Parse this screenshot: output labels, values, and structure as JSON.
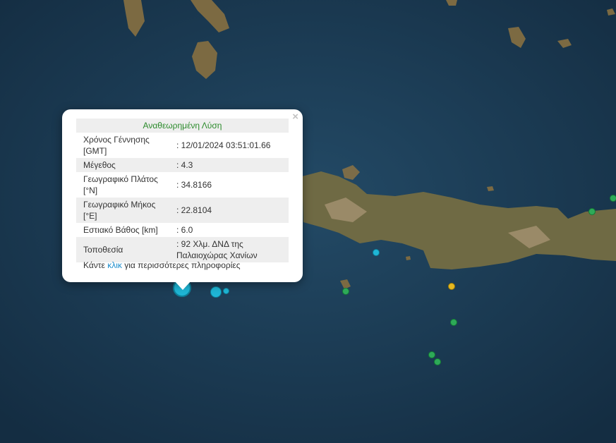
{
  "popup": {
    "title": "Αναθεωρημένη Λύση",
    "close_symbol": "×",
    "rows": [
      {
        "label": "Χρόνος Γέννησης [GMT]",
        "value": ": 12/01/2024 03:51:01.66"
      },
      {
        "label": "Μέγεθος",
        "value": ": 4.3"
      },
      {
        "label": "Γεωγραφικό Πλάτος [°N]",
        "value": ": 34.8166"
      },
      {
        "label": "Γεωγραφικό Μήκος [°E]",
        "value": ": 22.8104"
      },
      {
        "label": "Εστιακό Βάθος [km]",
        "value": ": 6.0"
      },
      {
        "label": "Τοποθεσία",
        "value": ": 92 Χλμ. ΔΝΔ της Παλαιοχώρας Χανίων"
      }
    ],
    "more_prefix": "Κάντε ",
    "more_link": "κλικ",
    "more_suffix": " για περισσότερες πληροφορίες"
  },
  "colors": {
    "sea": "#1b3a52",
    "land": "#7d6e48",
    "marker_cyan": "#1fb6d6",
    "marker_green": "#2eaa58",
    "marker_yellow": "#e6b820",
    "popup_title": "#2a8a2a",
    "link": "#1a8ccc"
  },
  "markers": [
    {
      "id": "quake-selected",
      "color": "marker_cyan",
      "size": "large"
    },
    {
      "id": "quake-cyan-2",
      "color": "marker_cyan",
      "size": "medium"
    },
    {
      "id": "quake-cyan-3",
      "color": "marker_cyan",
      "size": "small"
    },
    {
      "id": "quake-cyan-4",
      "color": "marker_cyan",
      "size": "small"
    },
    {
      "id": "quake-green-1",
      "color": "marker_green",
      "size": "small"
    },
    {
      "id": "quake-green-2",
      "color": "marker_green",
      "size": "small"
    },
    {
      "id": "quake-green-3",
      "color": "marker_green",
      "size": "small"
    },
    {
      "id": "quake-green-4",
      "color": "marker_green",
      "size": "small"
    },
    {
      "id": "quake-green-5",
      "color": "marker_green",
      "size": "small"
    },
    {
      "id": "quake-green-6",
      "color": "marker_green",
      "size": "small"
    },
    {
      "id": "quake-yellow-1",
      "color": "marker_yellow",
      "size": "small"
    }
  ]
}
